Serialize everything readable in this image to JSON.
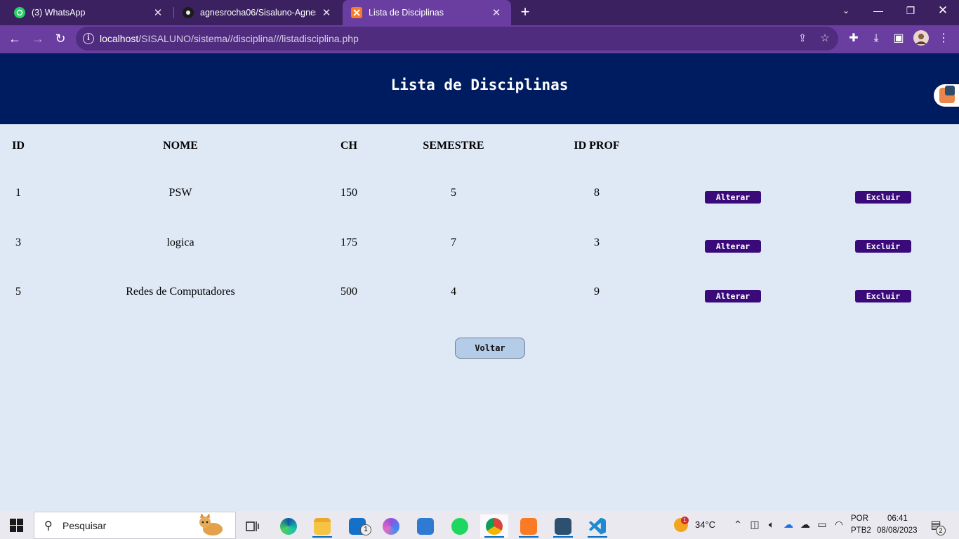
{
  "browser": {
    "tabs": [
      {
        "label": "(3) WhatsApp",
        "icon": "whatsapp-icon"
      },
      {
        "label": "agnesrocha06/Sisaluno-Agnes: R",
        "icon": "github-icon"
      },
      {
        "label": "Lista de Disciplinas",
        "icon": "xampp-icon",
        "active": true
      }
    ],
    "url_host": "localhost",
    "url_path": "/SISALUNO/sistema//disciplina///listadisciplina.php"
  },
  "page": {
    "title": "Lista de Disciplinas",
    "table": {
      "headers": [
        "ID",
        "NOME",
        "CH",
        "SEMESTRE",
        "ID PROF"
      ],
      "rows": [
        {
          "id": "1",
          "nome": "PSW",
          "ch": "150",
          "semestre": "5",
          "id_prof": "8"
        },
        {
          "id": "3",
          "nome": "logica",
          "ch": "175",
          "semestre": "7",
          "id_prof": "3"
        },
        {
          "id": "5",
          "nome": "Redes de Computadores",
          "ch": "500",
          "semestre": "4",
          "id_prof": "9"
        }
      ],
      "alter_label": "Alterar",
      "delete_label": "Excluir"
    },
    "back_label": "Voltar"
  },
  "taskbar": {
    "search_placeholder": "Pesquisar",
    "weather": "34°C",
    "weather_badge": "1",
    "lang_top": "POR",
    "lang_bottom": "PTB2",
    "time": "06:41",
    "date": "08/08/2023",
    "notif_count": "2",
    "mail_badge": "1"
  },
  "colors": {
    "header_bg": "#001c60",
    "page_bg": "#dfe8f5",
    "button_bg": "#3a0a7a",
    "back_button_bg": "#b5cce9",
    "tabbar_bg": "#3b2160",
    "toolbar_bg": "#6a3ea1"
  }
}
